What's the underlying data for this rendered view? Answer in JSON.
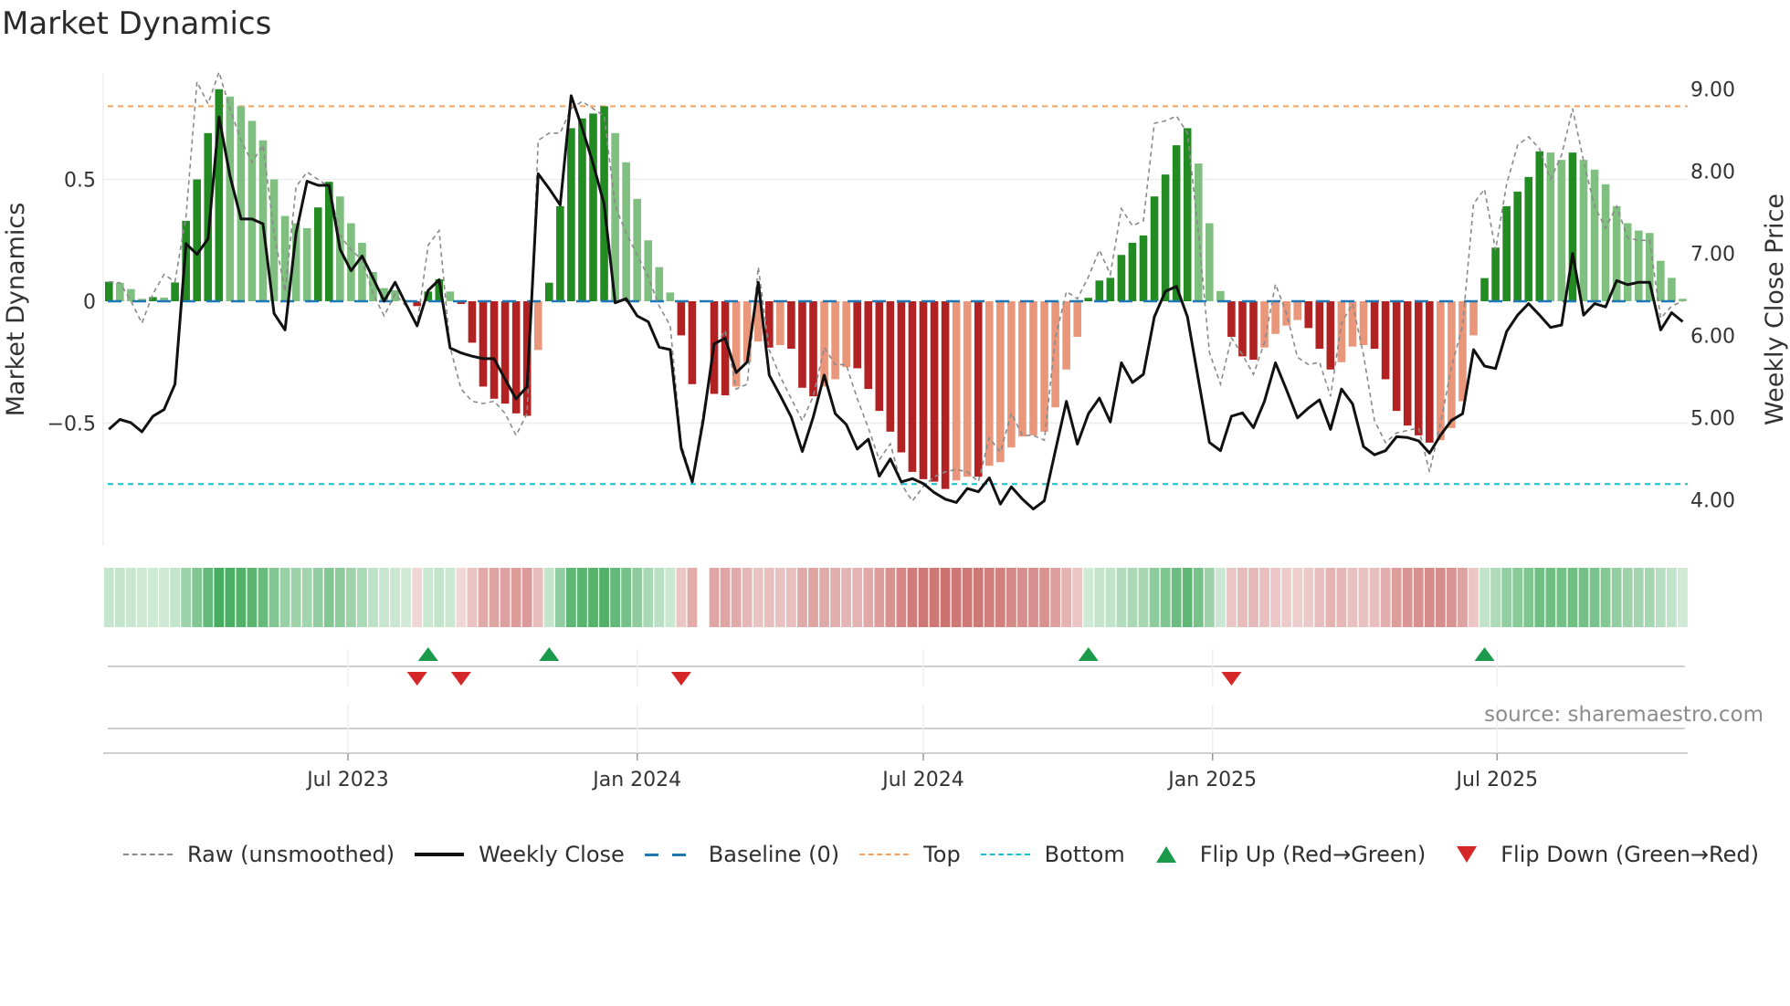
{
  "title": "Market Dynamics",
  "source": "source: sharemaestro.com",
  "legend": [
    {
      "label": "Raw (unsmoothed)",
      "kind": "raw"
    },
    {
      "label": "Weekly Close",
      "kind": "close"
    },
    {
      "label": "Baseline (0)",
      "kind": "baseline"
    },
    {
      "label": "Top",
      "kind": "top"
    },
    {
      "label": "Bottom",
      "kind": "bottom"
    },
    {
      "label": "Flip Up (Red→Green)",
      "kind": "flip-up"
    },
    {
      "label": "Flip Down (Green→Red)",
      "kind": "flip-down"
    }
  ],
  "colors": {
    "pos_strong": "#228b22",
    "pos_weak": "#7fbf7f",
    "neg_strong": "#b22222",
    "neg_weak": "#e9967a",
    "raw": "#8a8a8a",
    "close": "#111111",
    "baseline": "#1f77b4",
    "top": "#f4a460",
    "bottom": "#17becf",
    "flip_up": "#1a9a4a",
    "flip_down": "#d62728",
    "heat_pos": "#2ca048",
    "heat_neg": "#c0504d"
  },
  "chart_data": {
    "type": "bar",
    "title": "Market Dynamics",
    "xlabel": "",
    "ylabel": "Market Dynamics",
    "y2label": "Weekly Close Price",
    "start_date": "2023-01-30",
    "frequency_days": 7,
    "x_ticks": [
      {
        "label": "Jul 2023",
        "date": "2023-07-01"
      },
      {
        "label": "Jan 2024",
        "date": "2024-01-01"
      },
      {
        "label": "Jul 2024",
        "date": "2024-07-01"
      },
      {
        "label": "Jan 2025",
        "date": "2025-01-01"
      },
      {
        "label": "Jul 2025",
        "date": "2025-07-01"
      }
    ],
    "y_ticks": [
      {
        "label": "0.5",
        "value": 0.5
      },
      {
        "label": "0",
        "value": 0
      },
      {
        "label": "−0.5",
        "value": -0.5
      }
    ],
    "y2_ticks": [
      {
        "label": "9.00",
        "value": 9
      },
      {
        "label": "8.00",
        "value": 8
      },
      {
        "label": "7.00",
        "value": 7
      },
      {
        "label": "6.00",
        "value": 6
      },
      {
        "label": "5.00",
        "value": 5
      },
      {
        "label": "4.00",
        "value": 4
      }
    ],
    "ylim": [
      -0.95,
      0.93
    ],
    "y2lim": [
      3.7,
      9.2
    ],
    "top_level": 0.8,
    "bottom_level": -0.75,
    "baseline": 0,
    "grid": true,
    "legend_position": "bottom",
    "series": [
      {
        "name": "Market Dynamics",
        "values": [
          0.08,
          0.076,
          0.05,
          0.01,
          0.017,
          0.015,
          0.077,
          0.33,
          0.5,
          0.69,
          0.87,
          0.84,
          0.8,
          0.74,
          0.66,
          0.5,
          0.35,
          0.32,
          0.3,
          0.385,
          0.49,
          0.43,
          0.32,
          0.24,
          0.12,
          0.054,
          0.045,
          0.005,
          -0.02,
          0.04,
          0.09,
          0.04,
          -0.011,
          -0.17,
          -0.35,
          -0.4,
          -0.42,
          -0.46,
          -0.47,
          -0.2,
          0.076,
          0.39,
          0.71,
          0.75,
          0.77,
          0.8,
          0.69,
          0.57,
          0.42,
          0.25,
          0.14,
          0.036,
          -0.14,
          -0.34,
          null,
          -0.38,
          -0.386,
          -0.35,
          -0.25,
          -0.165,
          -0.19,
          -0.18,
          -0.195,
          -0.355,
          -0.39,
          -0.35,
          -0.32,
          -0.27,
          -0.275,
          -0.36,
          -0.45,
          -0.535,
          -0.62,
          -0.7,
          -0.73,
          -0.74,
          -0.77,
          -0.735,
          -0.72,
          -0.72,
          -0.675,
          -0.66,
          -0.6,
          -0.555,
          -0.55,
          -0.535,
          -0.435,
          -0.28,
          -0.146,
          0.014,
          0.085,
          0.096,
          0.19,
          0.24,
          0.27,
          0.43,
          0.52,
          0.64,
          0.71,
          0.565,
          0.32,
          0.042,
          -0.146,
          -0.226,
          -0.24,
          -0.19,
          -0.134,
          -0.1,
          -0.077,
          -0.11,
          -0.195,
          -0.28,
          -0.25,
          -0.186,
          -0.18,
          -0.195,
          -0.32,
          -0.45,
          -0.51,
          -0.55,
          -0.58,
          -0.57,
          -0.52,
          -0.41,
          -0.14,
          0.095,
          0.22,
          0.39,
          0.45,
          0.51,
          0.615,
          0.61,
          0.58,
          0.61,
          0.58,
          0.54,
          0.48,
          0.39,
          0.32,
          0.29,
          0.28,
          0.166,
          0.096,
          0.01
        ]
      },
      {
        "name": "Raw (unsmoothed)",
        "values": [
          0.08,
          0.076,
          0.0,
          -0.09,
          0.03,
          0.11,
          0.08,
          0.35,
          0.9,
          0.81,
          0.94,
          0.79,
          0.66,
          0.57,
          0.64,
          0.28,
          0.04,
          0.47,
          0.53,
          0.5,
          0.47,
          0.27,
          0.21,
          0.17,
          0.03,
          -0.06,
          0.03,
          -0.02,
          -0.1,
          0.23,
          0.29,
          -0.19,
          -0.36,
          -0.41,
          -0.42,
          -0.41,
          -0.46,
          -0.55,
          -0.46,
          0.66,
          0.69,
          0.69,
          0.79,
          0.82,
          0.79,
          0.76,
          0.39,
          0.28,
          0.19,
          0.1,
          -0.02,
          -0.1,
          -0.585,
          -0.735,
          -0.46,
          -0.19,
          -0.12,
          -0.36,
          -0.34,
          0.14,
          -0.2,
          -0.31,
          -0.4,
          -0.49,
          -0.39,
          -0.19,
          -0.26,
          -0.26,
          -0.4,
          -0.52,
          -0.65,
          -0.585,
          -0.75,
          -0.82,
          -0.76,
          -0.72,
          -0.7,
          -0.69,
          -0.7,
          -0.74,
          -0.56,
          -0.62,
          -0.46,
          -0.55,
          -0.55,
          -0.57,
          -0.15,
          0.04,
          0.01,
          0.1,
          0.21,
          0.11,
          0.38,
          0.31,
          0.33,
          0.73,
          0.74,
          0.76,
          0.69,
          0.28,
          -0.21,
          -0.34,
          -0.15,
          -0.22,
          -0.3,
          -0.17,
          0.07,
          -0.05,
          -0.23,
          -0.26,
          -0.25,
          -0.39,
          -0.09,
          -0.01,
          -0.22,
          -0.49,
          -0.58,
          -0.54,
          -0.53,
          -0.52,
          -0.7,
          -0.5,
          -0.27,
          -0.1,
          0.4,
          0.46,
          0.21,
          0.48,
          0.64,
          0.675,
          0.625,
          0.5,
          0.6,
          0.79,
          0.575,
          0.39,
          0.3,
          0.39,
          0.26,
          0.25,
          0.25,
          -0.07,
          -0.02,
          0.0
        ]
      },
      {
        "name": "Weekly Close",
        "axis": "right",
        "values": [
          4.86,
          4.98,
          4.94,
          4.83,
          5.02,
          5.1,
          5.41,
          7.12,
          6.99,
          7.18,
          8.66,
          7.94,
          7.42,
          7.42,
          7.36,
          6.27,
          6.07,
          7.25,
          7.88,
          7.83,
          7.83,
          7.05,
          6.79,
          6.97,
          6.7,
          6.42,
          6.65,
          6.38,
          6.12,
          6.55,
          6.68,
          5.85,
          5.79,
          5.75,
          5.72,
          5.72,
          5.47,
          5.23,
          5.38,
          7.97,
          7.79,
          7.59,
          8.92,
          8.53,
          8.09,
          7.6,
          6.4,
          6.45,
          6.24,
          6.17,
          5.86,
          5.83,
          4.63,
          4.22,
          4.97,
          5.9,
          5.97,
          5.55,
          5.68,
          6.65,
          5.52,
          5.27,
          5.01,
          4.59,
          5.01,
          5.52,
          5.05,
          4.92,
          4.62,
          4.74,
          4.29,
          4.5,
          4.22,
          4.26,
          4.2,
          4.09,
          4.01,
          3.97,
          4.14,
          4.1,
          4.27,
          3.95,
          4.16,
          4.01,
          3.89,
          3.99,
          4.6,
          5.2,
          4.68,
          5.05,
          5.24,
          4.95,
          5.67,
          5.43,
          5.53,
          6.23,
          6.54,
          6.6,
          6.23,
          5.46,
          4.7,
          4.6,
          5.02,
          5.06,
          4.88,
          5.2,
          5.67,
          5.34,
          5.0,
          5.12,
          5.22,
          4.86,
          5.35,
          5.17,
          4.65,
          4.55,
          4.6,
          4.77,
          4.76,
          4.72,
          4.57,
          4.79,
          4.97,
          5.05,
          5.83,
          5.63,
          5.6,
          6.05,
          6.25,
          6.39,
          6.25,
          6.1,
          6.13,
          7.0,
          6.25,
          6.39,
          6.35,
          6.67,
          6.62,
          6.65,
          6.65,
          6.07,
          6.28,
          6.17
        ]
      }
    ],
    "flips_up_week_index": [
      30,
      41,
      90,
      126
    ],
    "flips_down_week_index": [
      29,
      33,
      53,
      103
    ]
  }
}
